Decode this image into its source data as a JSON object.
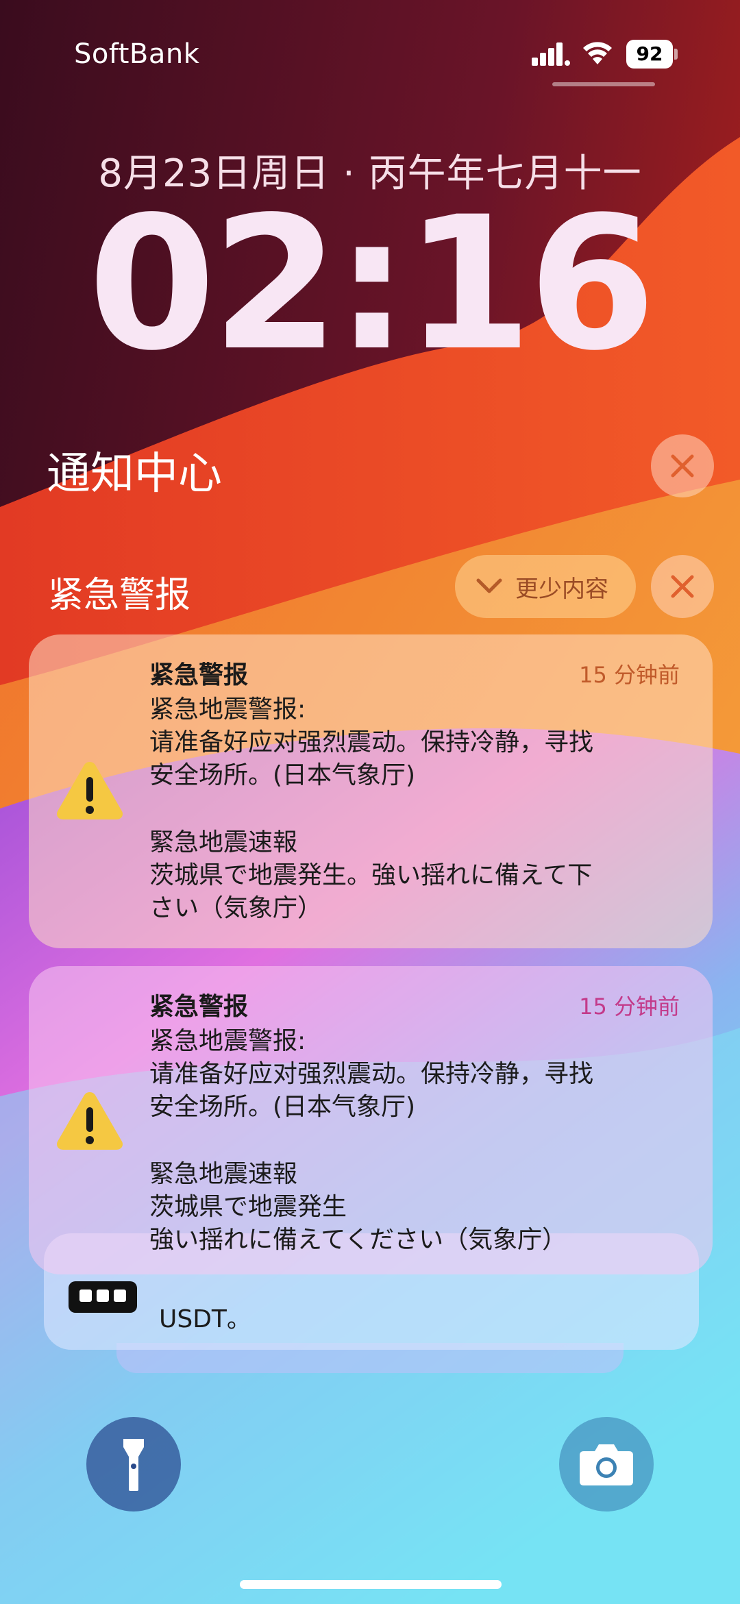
{
  "status_bar": {
    "carrier": "SoftBank",
    "battery": "92"
  },
  "lock": {
    "date": "8月23日周日 · 丙午年七月十一",
    "time": "02:16"
  },
  "notification_center": {
    "title": "通知中心"
  },
  "group": {
    "title": "紧急警报",
    "show_less_label": "更少内容"
  },
  "notifications": [
    {
      "app": "紧急警报",
      "time": "15 分钟前",
      "lines": [
        "紧急地震警报:",
        "请准备好应对强烈震动。保持冷静，寻找",
        "安全场所。(日本气象厅)",
        "緊急地震速報",
        "茨城県で地震発生。強い揺れに備えて下",
        "さい（気象庁）"
      ]
    },
    {
      "app": "紧急警报",
      "time": "15 分钟前",
      "lines": [
        "紧急地震警报:",
        "请准备好应对强烈震动。保持冷静，寻找",
        "安全场所。(日本气象厅)",
        "緊急地震速報",
        "茨城県で地震発生",
        "強い揺れに備えてください（気象庁）"
      ]
    }
  ],
  "stacked_notification": {
    "visible_text": "USDT。"
  },
  "icons": {
    "warning": "warning-triangle-icon",
    "flashlight": "flashlight-icon",
    "camera": "camera-icon",
    "close": "close-icon",
    "chevron": "chevron-down-icon"
  },
  "colors": {
    "alert_icon": "#f5c842",
    "close_x": "#e0602e",
    "card1_time": "#c05a2a",
    "card2_time": "#c33a8a"
  }
}
